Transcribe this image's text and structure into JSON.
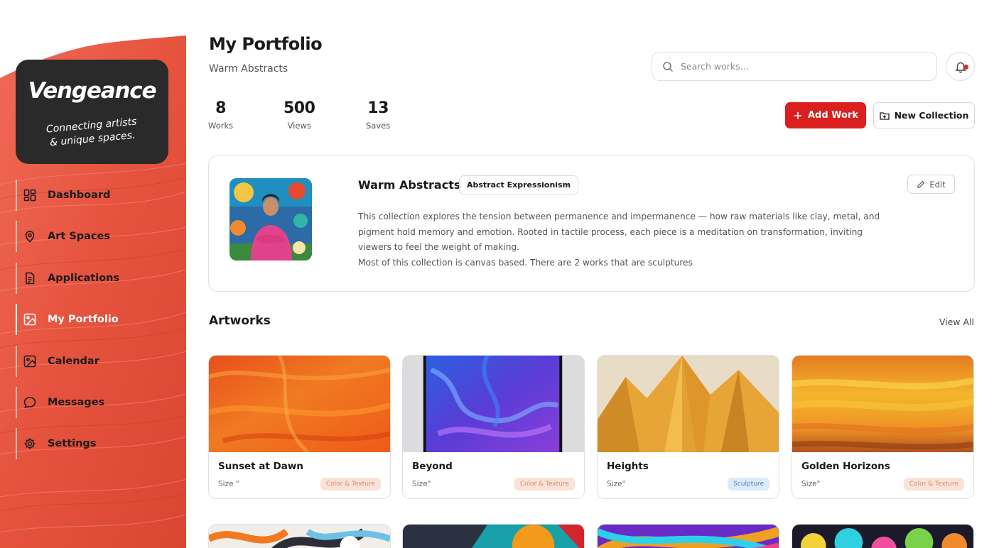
{
  "brand": {
    "name": "Vengeance",
    "tagline_line1": "Connecting artists",
    "tagline_line2": "& unique spaces."
  },
  "nav": [
    {
      "label": "Dashboard",
      "icon": "dashboard-icon",
      "active": false
    },
    {
      "label": "Art Spaces",
      "icon": "map-pin-icon",
      "active": false
    },
    {
      "label": "Applications",
      "icon": "document-icon",
      "active": false
    },
    {
      "label": "My Portfolio",
      "icon": "image-icon",
      "active": true
    },
    {
      "label": "Calendar",
      "icon": "image-icon",
      "active": false
    },
    {
      "label": "Messages",
      "icon": "chat-bubble-icon",
      "active": false
    },
    {
      "label": "Settings",
      "icon": "gear-icon",
      "active": false
    }
  ],
  "header": {
    "title": "My Portfolio",
    "subtitle": "Warm Abstracts",
    "search_placeholder": "Search works...",
    "has_notification": true
  },
  "stats": [
    {
      "value": "8",
      "label": "Works"
    },
    {
      "value": "500",
      "label": "Views"
    },
    {
      "value": "13",
      "label": "Saves"
    }
  ],
  "actions": {
    "add_work": "Add Work",
    "new_collection": "New Collection"
  },
  "collection": {
    "name": "Warm Abstracts",
    "tag": "Abstract Expressionism",
    "edit_label": "Edit",
    "desc_line1": "This collection explores the tension between permanence and impermanence — how raw materials like clay, metal, and",
    "desc_line2": "pigment hold memory and emotion. Rooted in tactile process, each piece is a meditation on transformation, inviting",
    "desc_line3": "viewers to feel the weight of making.",
    "desc_line4": "Most of this collection is canvas based. There are 2 works that are sculptures"
  },
  "artworks_section": {
    "title": "Artworks",
    "view_all": "View All"
  },
  "artworks": [
    {
      "title": "Sunset at Dawn",
      "size": "Size \"",
      "tag": "Color & Texture",
      "tag_style": "warm"
    },
    {
      "title": "Beyond",
      "size": "Size\"",
      "tag": "Color & Texture",
      "tag_style": "warm"
    },
    {
      "title": "Heights",
      "size": "Size\"",
      "tag": "Sculpture",
      "tag_style": "cool"
    },
    {
      "title": "Golden Horizons",
      "size": "Size\"",
      "tag": "Color & Texture",
      "tag_style": "warm"
    }
  ],
  "colors": {
    "accent": "#d9201f",
    "sidebar_paint": "#e8553f",
    "brand_card": "#2a2a2a"
  }
}
